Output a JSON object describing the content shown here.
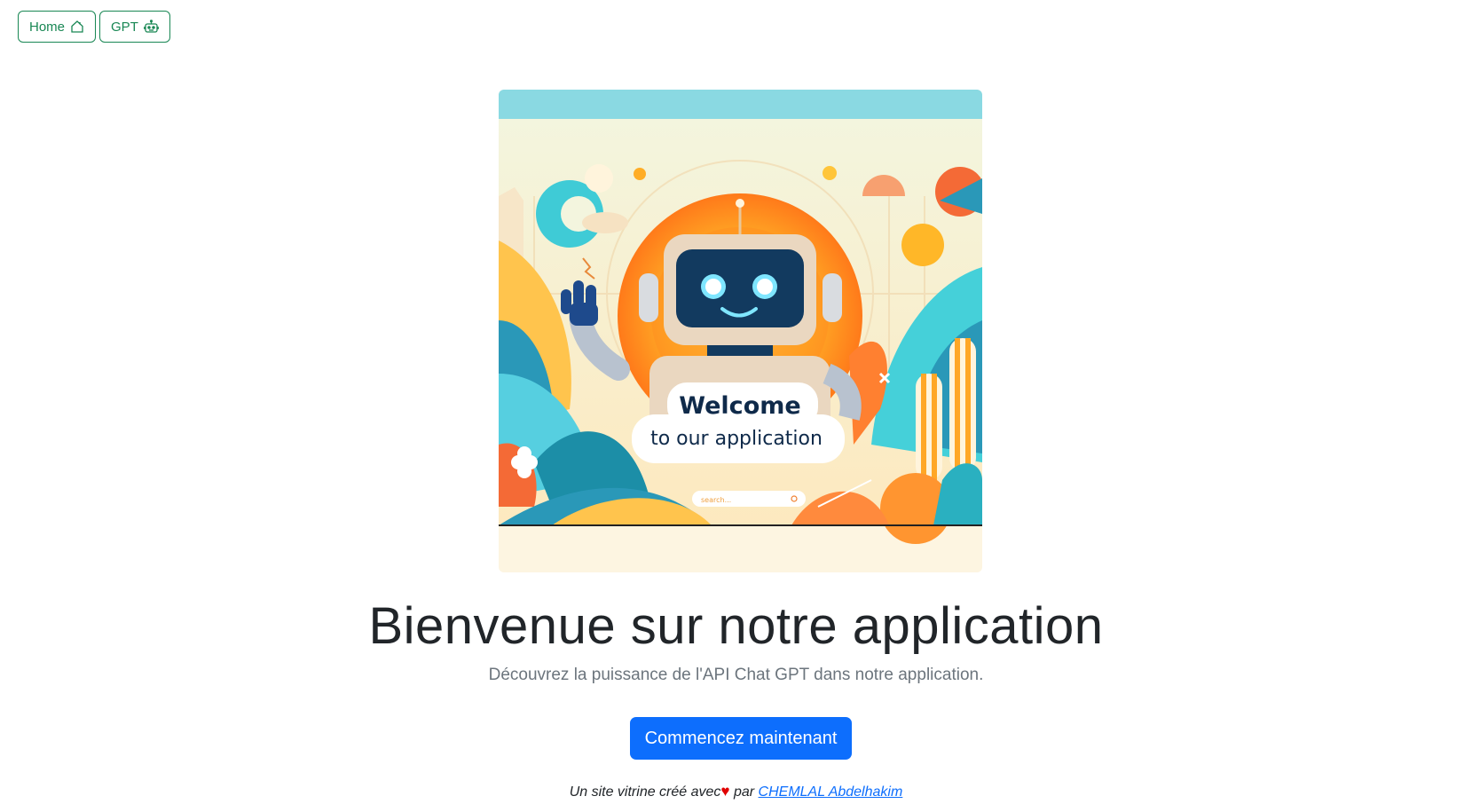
{
  "nav": {
    "home_label": "Home",
    "home_icon": "house-icon",
    "gpt_label": "GPT",
    "gpt_icon": "robot-icon"
  },
  "hero_image": {
    "welcome_text": "Welcome",
    "welcome_sub": "to our application",
    "search_placeholder": "search..."
  },
  "main": {
    "title": "Bienvenue sur notre application",
    "subtitle": "Découvrez la puissance de l'API Chat GPT dans notre application.",
    "cta_label": "Commencez maintenant"
  },
  "footer": {
    "prefix": "Un site vitrine créé avec",
    "heart": "♥",
    "middle": "par",
    "author_link": "CHEMLAL Abdelhakim"
  },
  "colors": {
    "nav_accent": "#198754",
    "cta_bg": "#0d6efd",
    "heart": "#e00000"
  }
}
